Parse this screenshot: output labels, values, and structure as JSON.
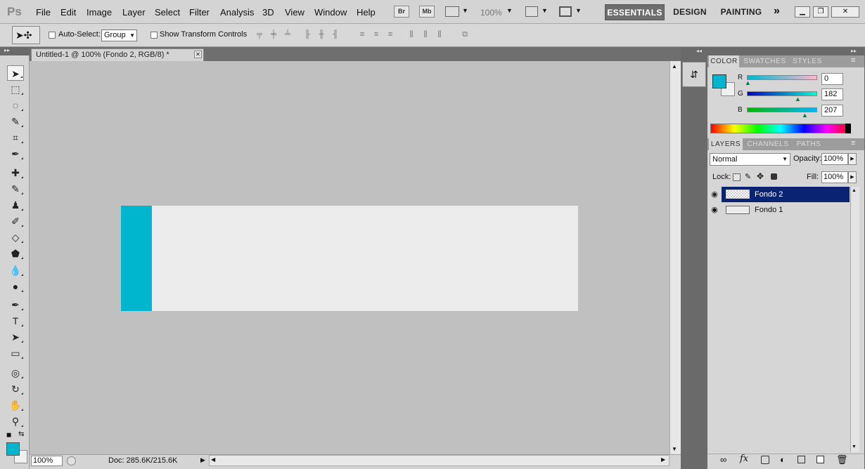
{
  "app": {
    "logo": "Ps"
  },
  "menu": [
    "File",
    "Edit",
    "Image",
    "Layer",
    "Select",
    "Filter",
    "Analysis",
    "3D",
    "View",
    "Window",
    "Help"
  ],
  "appbar": {
    "br_label": "Br",
    "mb_label": "Mb",
    "zoom": "100%"
  },
  "workspaces": [
    "ESSENTIALS",
    "DESIGN",
    "PAINTING"
  ],
  "options": {
    "auto_select_label": "Auto-Select:",
    "auto_select_value": "Group",
    "show_transform_label": "Show Transform Controls"
  },
  "document": {
    "tab_title": "Untitled-1 @ 100% (Fondo 2, RGB/8) *",
    "zoom": "100%",
    "doc_info": "Doc: 285.6K/215.6K",
    "fill_color": "#00b6cf",
    "bg_color": "#ececec"
  },
  "tools": [
    "move-tool",
    "marquee-tool",
    "lasso-tool",
    "quick-select-tool",
    "crop-tool",
    "eyedropper-tool",
    "healing-brush-tool",
    "brush-tool",
    "clone-stamp-tool",
    "history-brush-tool",
    "eraser-tool",
    "paint-bucket-tool",
    "blur-tool",
    "dodge-tool",
    "pen-tool",
    "type-tool",
    "path-select-tool",
    "rectangle-tool",
    "3d-rotate-tool",
    "3d-orbit-tool",
    "hand-tool",
    "zoom-tool"
  ],
  "color_panel": {
    "tabs": [
      "COLOR",
      "SWATCHES",
      "STYLES"
    ],
    "channels": [
      {
        "label": "R",
        "value": "0"
      },
      {
        "label": "G",
        "value": "182"
      },
      {
        "label": "B",
        "value": "207"
      }
    ],
    "foreground": "#00b6cf",
    "background": "#f0f0f0"
  },
  "layers_panel": {
    "tabs": [
      "LAYERS",
      "CHANNELS",
      "PATHS"
    ],
    "blend_mode": "Normal",
    "opacity_label": "Opacity:",
    "opacity": "100%",
    "lock_label": "Lock:",
    "fill_label": "Fill:",
    "fill": "100%",
    "layers": [
      {
        "name": "Fondo 2",
        "selected": true
      },
      {
        "name": "Fondo 1",
        "selected": false
      }
    ],
    "footer_fx": "fx"
  }
}
